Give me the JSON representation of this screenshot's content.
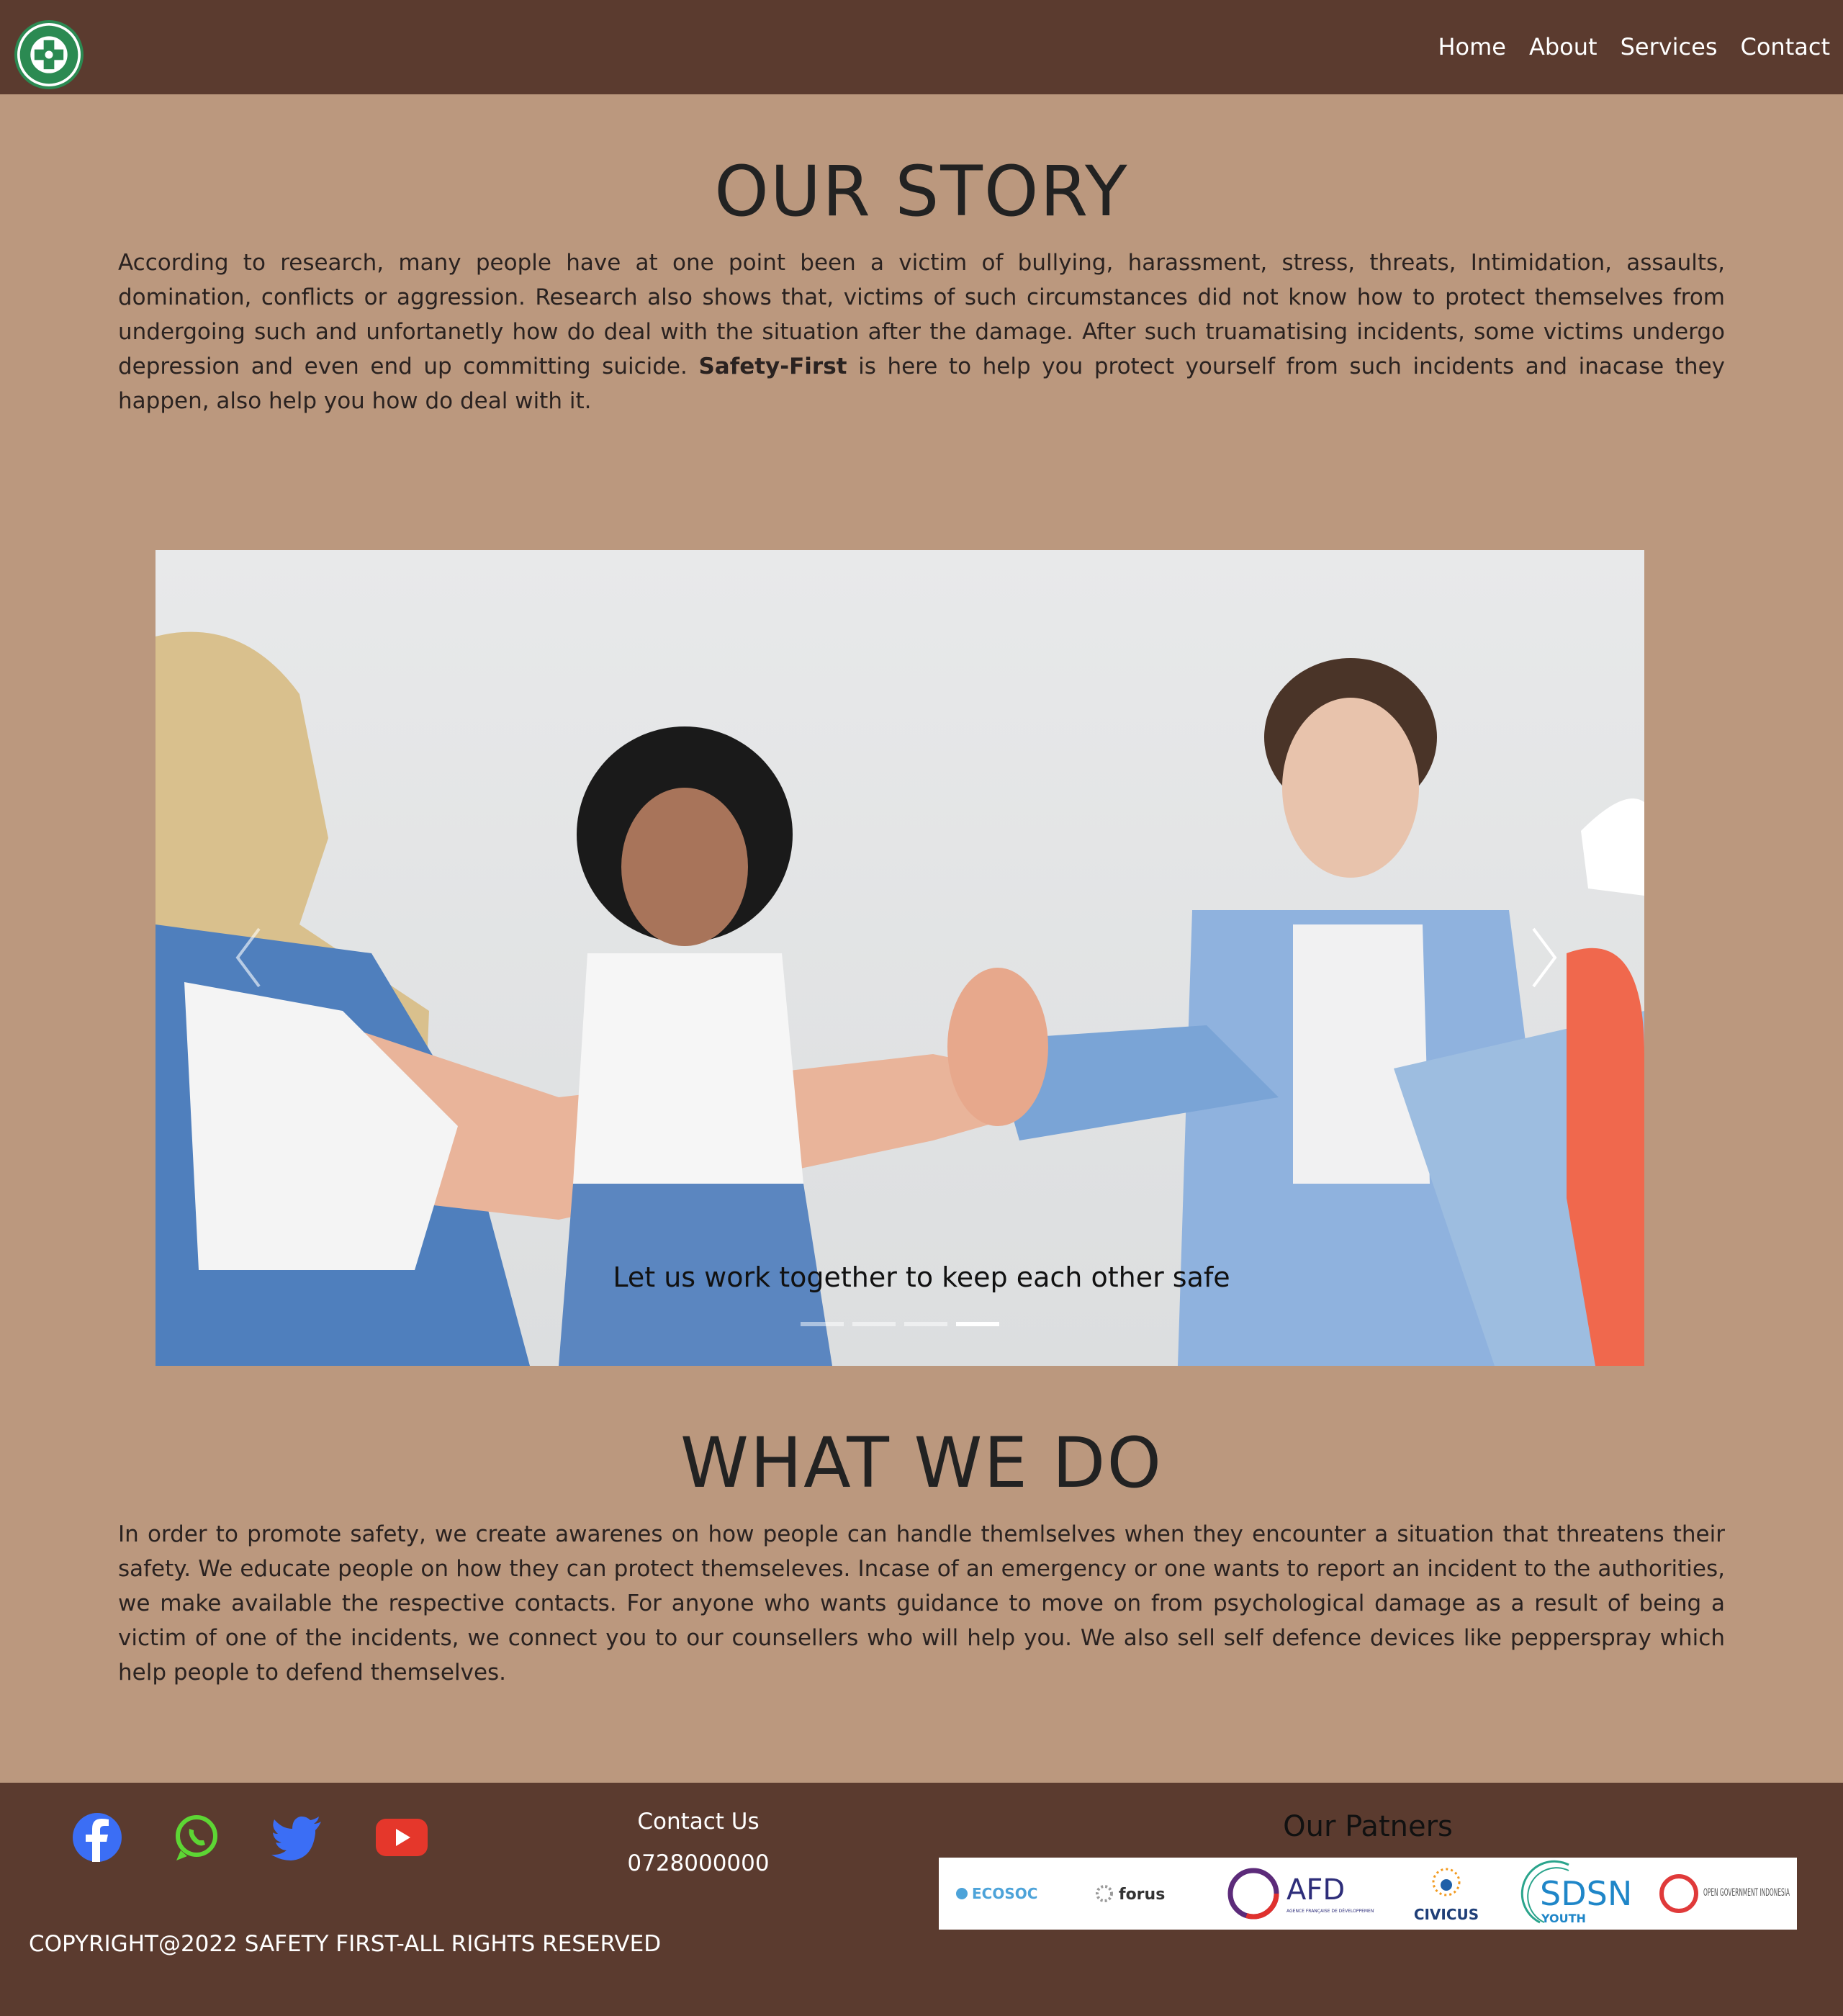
{
  "nav": {
    "logo_icon": "safety-first-logo",
    "links": [
      "Home",
      "About",
      "Services",
      "Contact"
    ]
  },
  "story": {
    "title": "OUR STORY",
    "text_before": "According to research, many people have at one point been a victim of bullying, harassment, stress, threats, Intimidation, assaults, domination, conflicts or aggression. Research also shows that, victims of such circumstances did not know how to protect themselves from undergoing such and unfortanetly how do deal with the situation after the damage. After such truamatising incidents, some victims undergo depression and even end up committing suicide. ",
    "brand": "Safety-First",
    "text_after": " is here to help you protect yourself from such incidents and inacase they happen, also help you how do deal with it."
  },
  "carousel": {
    "caption": "Let us work together to keep each other safe",
    "prev_icon": "chevron-left-icon",
    "next_icon": "chevron-right-icon",
    "slide_count": 4,
    "active_slide": 4
  },
  "what": {
    "title": "WHAT WE DO",
    "text": "In order to promote safety, we create awarenes on how people can handle themlselves when they encounter a situation that threatens their safety. We educate people on how they can protect themseleves. Incase of an emergency or one wants to report an incident to the authorities, we make available the respective contacts. For anyone who wants guidance to move on from psychological damage as a result of being a victim of one of the incidents, we connect you to our counsellers who will help you. We also sell self defence devices like pepperspray which help people to defend themselves."
  },
  "footer": {
    "social": [
      {
        "icon": "facebook-icon",
        "color": "#3b6ef5"
      },
      {
        "icon": "whatsapp-icon",
        "color": "#5dd634"
      },
      {
        "icon": "twitter-icon",
        "color": "#3b6ef5"
      },
      {
        "icon": "youtube-icon",
        "color": "#e5372b"
      }
    ],
    "contact_title": "Contact Us",
    "contact_phone": "0728000000",
    "partners_title": "Our Patners",
    "partners": [
      {
        "name": "ECOSOC"
      },
      {
        "name": "forus"
      },
      {
        "name": "AFD",
        "sub": "AGENCE FRANÇAISE DE DÉVELOPPEMENT"
      },
      {
        "name": "CIVICUS"
      },
      {
        "name": "SDSN",
        "sub": "YOUTH"
      },
      {
        "name": "OPEN GOVERNMENT INDONESIA"
      }
    ],
    "copyright": "COPYRIGHT@2022 SAFETY FIRST-ALL RIGHTS RESERVED"
  },
  "colors": {
    "nav_bg": "#5b3b2f",
    "page_bg": "#bb987e",
    "footer_bg": "#5b3b2f",
    "heading": "#222222"
  }
}
